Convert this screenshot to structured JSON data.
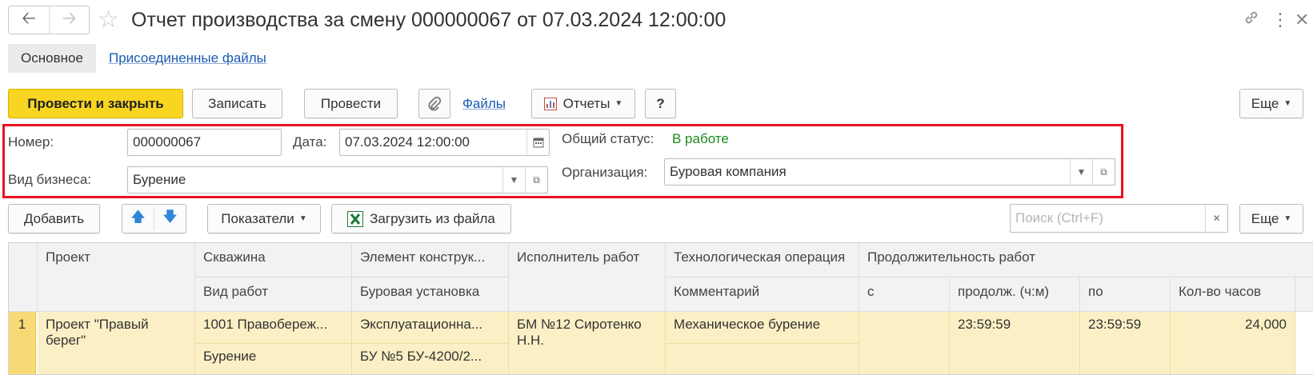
{
  "window": {
    "title": "Отчет производства за смену 000000067 от 07.03.2024 12:00:00"
  },
  "tabs": [
    {
      "label": "Основное"
    },
    {
      "label": "Присоединенные файлы"
    }
  ],
  "toolbar": {
    "post_close_label": "Провести и закрыть",
    "save_label": "Записать",
    "post_label": "Провести",
    "files_label": "Файлы",
    "reports_label": "Отчеты",
    "help_label": "?",
    "more_label": "Еще"
  },
  "header": {
    "number_label": "Номер:",
    "number_value": "000000067",
    "date_label": "Дата:",
    "date_value": "07.03.2024 12:00:00",
    "business_label": "Вид бизнеса:",
    "business_value": "Бурение",
    "status_label": "Общий статус:",
    "status_value": "В работе",
    "org_label": "Организация:",
    "org_value": "Буровая компания",
    "status_color": "#1e8a1e",
    "highlight_color": "#e8141b"
  },
  "table_toolbar": {
    "add_label": "Добавить",
    "indicators_label": "Показатели",
    "load_label": "Загрузить из файла",
    "search_placeholder": "Поиск (Ctrl+F)",
    "more_label": "Еще"
  },
  "table": {
    "headers_row1": {
      "project": "Проект",
      "well": "Скважина",
      "element": "Элемент конструк...",
      "executor": "Исполнитель работ",
      "operation": "Технологическая операция",
      "duration": "Продолжительность работ"
    },
    "headers_row2": {
      "work_type": "Вид работ",
      "rig": "Буровая установка",
      "comment": "Комментарий",
      "from": "с",
      "length": "продолж. (ч:м)",
      "to": "по",
      "hours": "Кол-во часов"
    },
    "rows": [
      {
        "num": "1",
        "project_line1": "Проект \"Правый",
        "project_line2": "берег\"",
        "well": "1001 Правобереж...",
        "work_type": "Бурение",
        "element": "Эксплуатационна...",
        "rig": "БУ №5 БУ-4200/2...",
        "executor_line1": "БМ №12 Сиротенко",
        "executor_line2": "Н.Н.",
        "operation": "Механическое бурение",
        "comment": "",
        "from": "",
        "length": "23:59:59",
        "to": "23:59:59",
        "hours": "24,000"
      }
    ],
    "selected_row_color": "#fbf0c5"
  }
}
